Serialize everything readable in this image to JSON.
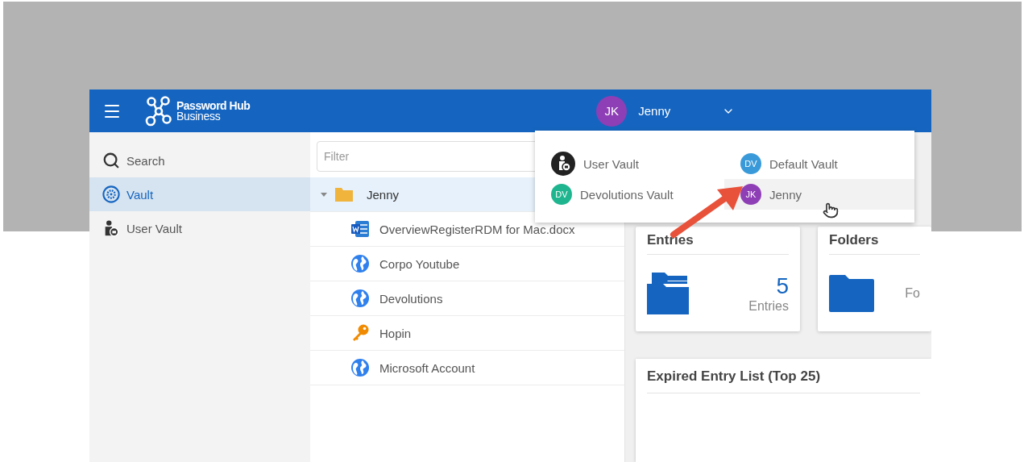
{
  "header": {
    "logo": {
      "line1": "Password Hub",
      "line2": "Business"
    },
    "user": {
      "initials": "JK",
      "name": "Jenny",
      "color": "#8e3fb5"
    }
  },
  "sidebar": {
    "items": [
      {
        "label": "Search",
        "kind": "search",
        "selected": false
      },
      {
        "label": "Vault",
        "kind": "vault",
        "selected": true
      },
      {
        "label": "User Vault",
        "kind": "user",
        "selected": false
      }
    ]
  },
  "tree": {
    "filter": {
      "placeholder": "Filter"
    },
    "folder": {
      "label": "Jenny",
      "expanded": true,
      "selected": true,
      "children": [
        {
          "label": "OverviewRegisterRDM for Mac.docx",
          "kind": "document"
        },
        {
          "label": "Corpo Youtube",
          "kind": "web"
        },
        {
          "label": "Devolutions",
          "kind": "web"
        },
        {
          "label": "Hopin",
          "kind": "key"
        },
        {
          "label": "Microsoft Account",
          "kind": "web"
        }
      ]
    }
  },
  "dashboard": {
    "cards": [
      {
        "title": "Entries",
        "value": "5",
        "caption": "Entries",
        "kind": "entries"
      },
      {
        "title": "Folders",
        "caption": "Fo",
        "kind": "folders"
      }
    ],
    "expired": {
      "title": "Expired Entry List (Top 25)"
    }
  },
  "vault_menu": {
    "items": [
      {
        "label": "User Vault",
        "kind": "user",
        "highlighted": false
      },
      {
        "label": "Default Vault",
        "kind": "avatar",
        "initials": "DV",
        "color": "#3a9ad9",
        "highlighted": false
      },
      {
        "label": "Devolutions Vault",
        "kind": "avatar",
        "initials": "DV",
        "color": "#1fb58f",
        "highlighted": false
      },
      {
        "label": "Jenny",
        "kind": "avatar",
        "initials": "JK",
        "color": "#8e3fb5",
        "highlighted": true
      }
    ]
  }
}
